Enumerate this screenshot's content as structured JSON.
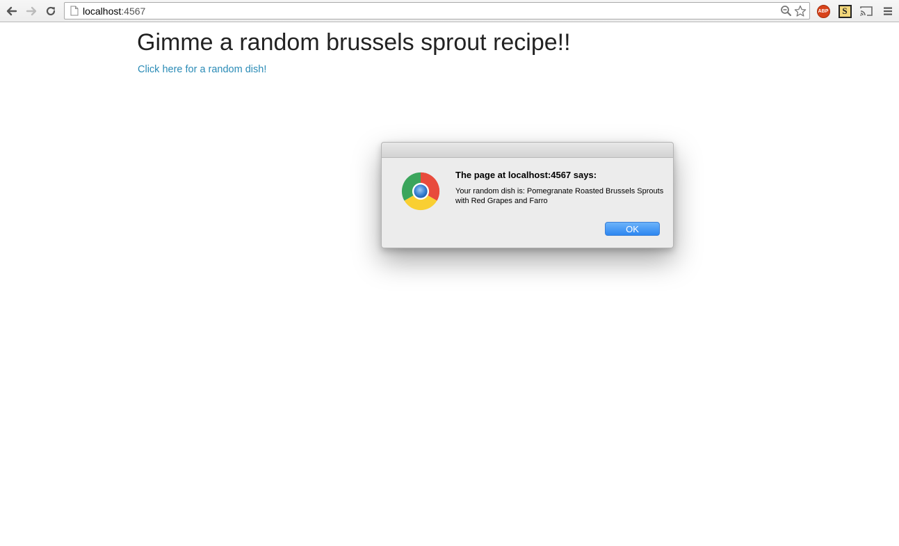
{
  "browser": {
    "url_host": "localhost",
    "url_port": ":4567",
    "icons": {
      "back": "back-arrow-icon",
      "forward": "forward-arrow-icon",
      "reload": "reload-icon",
      "page": "page-icon",
      "zoom": "zoom-icon",
      "bookmark": "star-icon",
      "cast": "cast-icon",
      "menu": "hamburger-menu-icon"
    },
    "extensions": {
      "adblock_label": "ABP",
      "s_ext_label": "S"
    }
  },
  "page": {
    "title": "Gimme a random brussels sprout recipe!!",
    "link_text": "Click here for a random dish!",
    "link_color": "#2a8bb6"
  },
  "dialog": {
    "heading": "The page at localhost:4567 says:",
    "message": "Your random dish is: Pomegranate Roasted Brussels Sprouts with Red Grapes and Farro",
    "ok_label": "OK",
    "logo": "chrome-logo-icon"
  }
}
